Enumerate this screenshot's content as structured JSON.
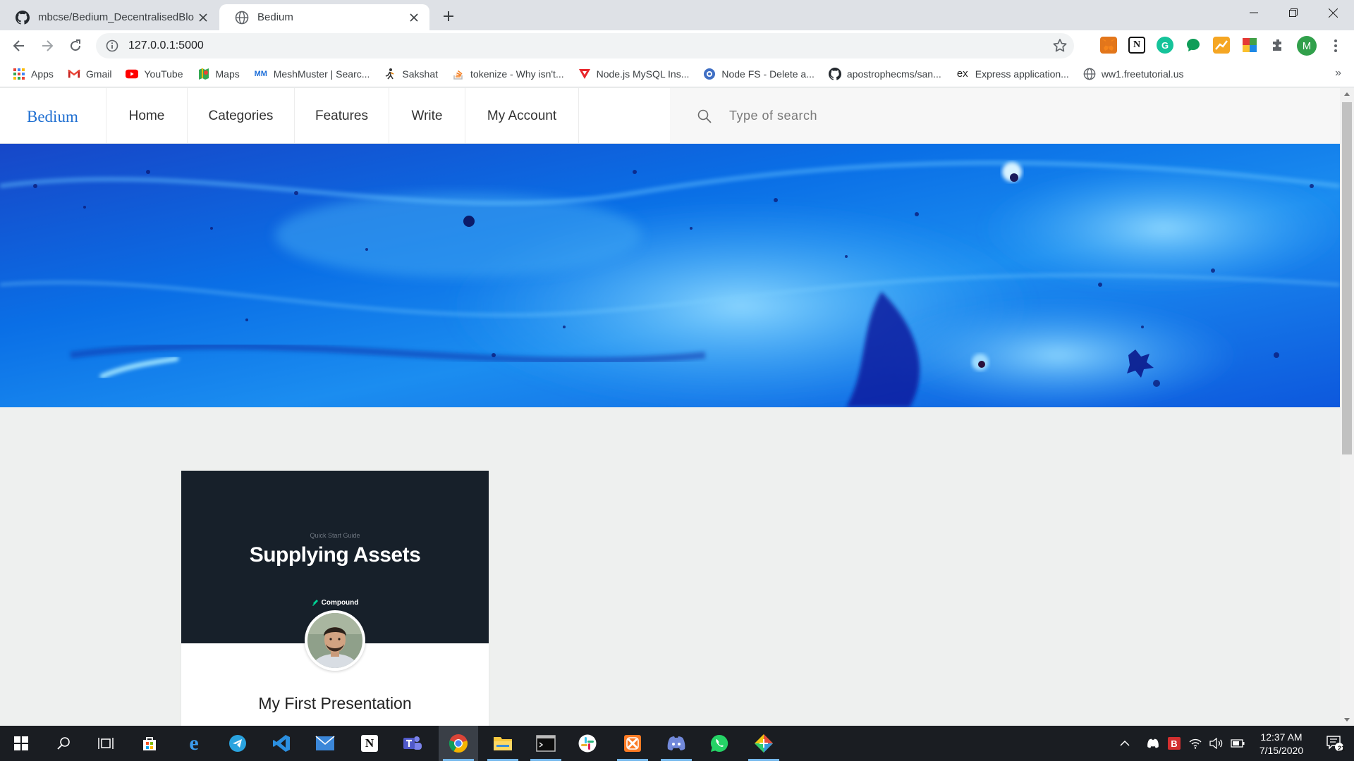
{
  "browser": {
    "tabs": [
      {
        "title": "mbcse/Bedium_DecentralisedBlo",
        "active": false
      },
      {
        "title": "Bedium",
        "active": true
      }
    ],
    "url": "127.0.0.1:5000",
    "profile_initial": "M",
    "bookmarks": [
      {
        "label": "Apps",
        "icon": "apps-grid-icon"
      },
      {
        "label": "Gmail",
        "icon": "gmail-icon"
      },
      {
        "label": "YouTube",
        "icon": "youtube-icon"
      },
      {
        "label": "Maps",
        "icon": "maps-icon"
      },
      {
        "label": "MeshMuster | Searc...",
        "icon": "meshmuster-icon",
        "icon_text": "MM"
      },
      {
        "label": "Sakshat",
        "icon": "sakshat-icon"
      },
      {
        "label": "tokenize - Why isn't...",
        "icon": "stackoverflow-icon"
      },
      {
        "label": "Node.js MySQL Ins...",
        "icon": "tutorial-icon"
      },
      {
        "label": "Node FS - Delete a...",
        "icon": "node-fs-icon"
      },
      {
        "label": "apostrophecms/san...",
        "icon": "github-icon"
      },
      {
        "label": "Express application...",
        "icon": "express-icon",
        "icon_text": "ex"
      },
      {
        "label": "ww1.freetutorial.us",
        "icon": "globe-icon"
      }
    ],
    "more_bookmarks": "»"
  },
  "site": {
    "brand": "Bedium",
    "nav": [
      "Home",
      "Categories",
      "Features",
      "Write",
      "My Account"
    ],
    "search_placeholder": "Type of search",
    "card": {
      "cover_kicker": "Quick Start Guide",
      "cover_title": "Supplying Assets",
      "cover_brand": "Compound",
      "title": "My First Presentation"
    }
  },
  "taskbar": {
    "time": "12:37 AM",
    "date": "7/15/2020",
    "notifications": "21"
  },
  "colors": {
    "brand": "#1f6fd1",
    "cover_bg": "#17202a",
    "taskbar_bg": "#1a1d22"
  }
}
